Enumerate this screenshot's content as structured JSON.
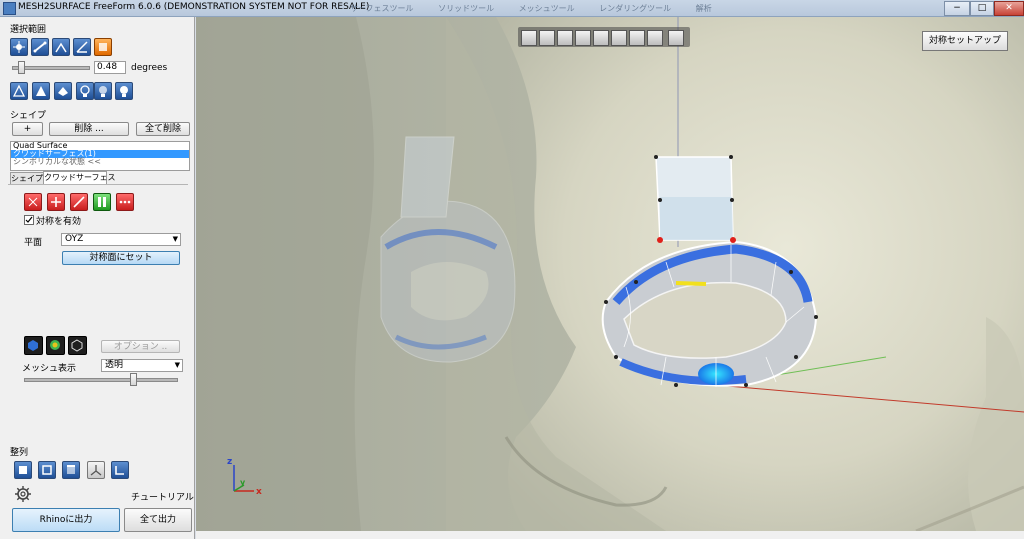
{
  "window": {
    "title": "MESH2SURFACE FreeForm 6.0.6 (DEMONSTRATION SYSTEM NOT FOR RESALE)",
    "menus": [
      "サーフェスツール",
      "ソリッドツール",
      "メッシュツール",
      "レンダリングツール",
      "解析"
    ],
    "minimize": "−",
    "maximize": "□",
    "close": "✕"
  },
  "panel": {
    "selection_range_label": "選択範囲",
    "angle_value": "0.48",
    "angle_unit": "degrees",
    "shape_section_label": "シェイプ",
    "add_label": "+",
    "delete_label": "削除 ...",
    "delete_all_label": "全て削除",
    "shape_list": [
      "Quad Surface",
      "クワッドサーフェス(1)",
      "シンボリカルな状態 <<"
    ],
    "tabs": [
      "シェイプ",
      "クワッドサーフェス"
    ],
    "symmetry_enable_label": "対称を有効",
    "plane_label": "平面",
    "plane_value": "OYZ",
    "set_symmetry_plane_label": "対称面にセット",
    "options_label": "オプション ..",
    "mesh_display_label": "メッシュ表示",
    "mesh_display_value": "透明",
    "align_label": "整列",
    "tutorial_label": "チュートリアル",
    "export_rhino_label": "Rhinoに出力",
    "export_all_label": "全て出力"
  },
  "viewport": {
    "symmetry_setup_label": "対称セットアップ",
    "axis_labels": {
      "z": "z",
      "y": "y",
      "x": "x"
    }
  },
  "colors": {
    "accent": "#3399ff",
    "surface_blue": "#3a6fe0",
    "control_point_red": "#e0201a",
    "highlight_yellow": "#f2e01c"
  }
}
